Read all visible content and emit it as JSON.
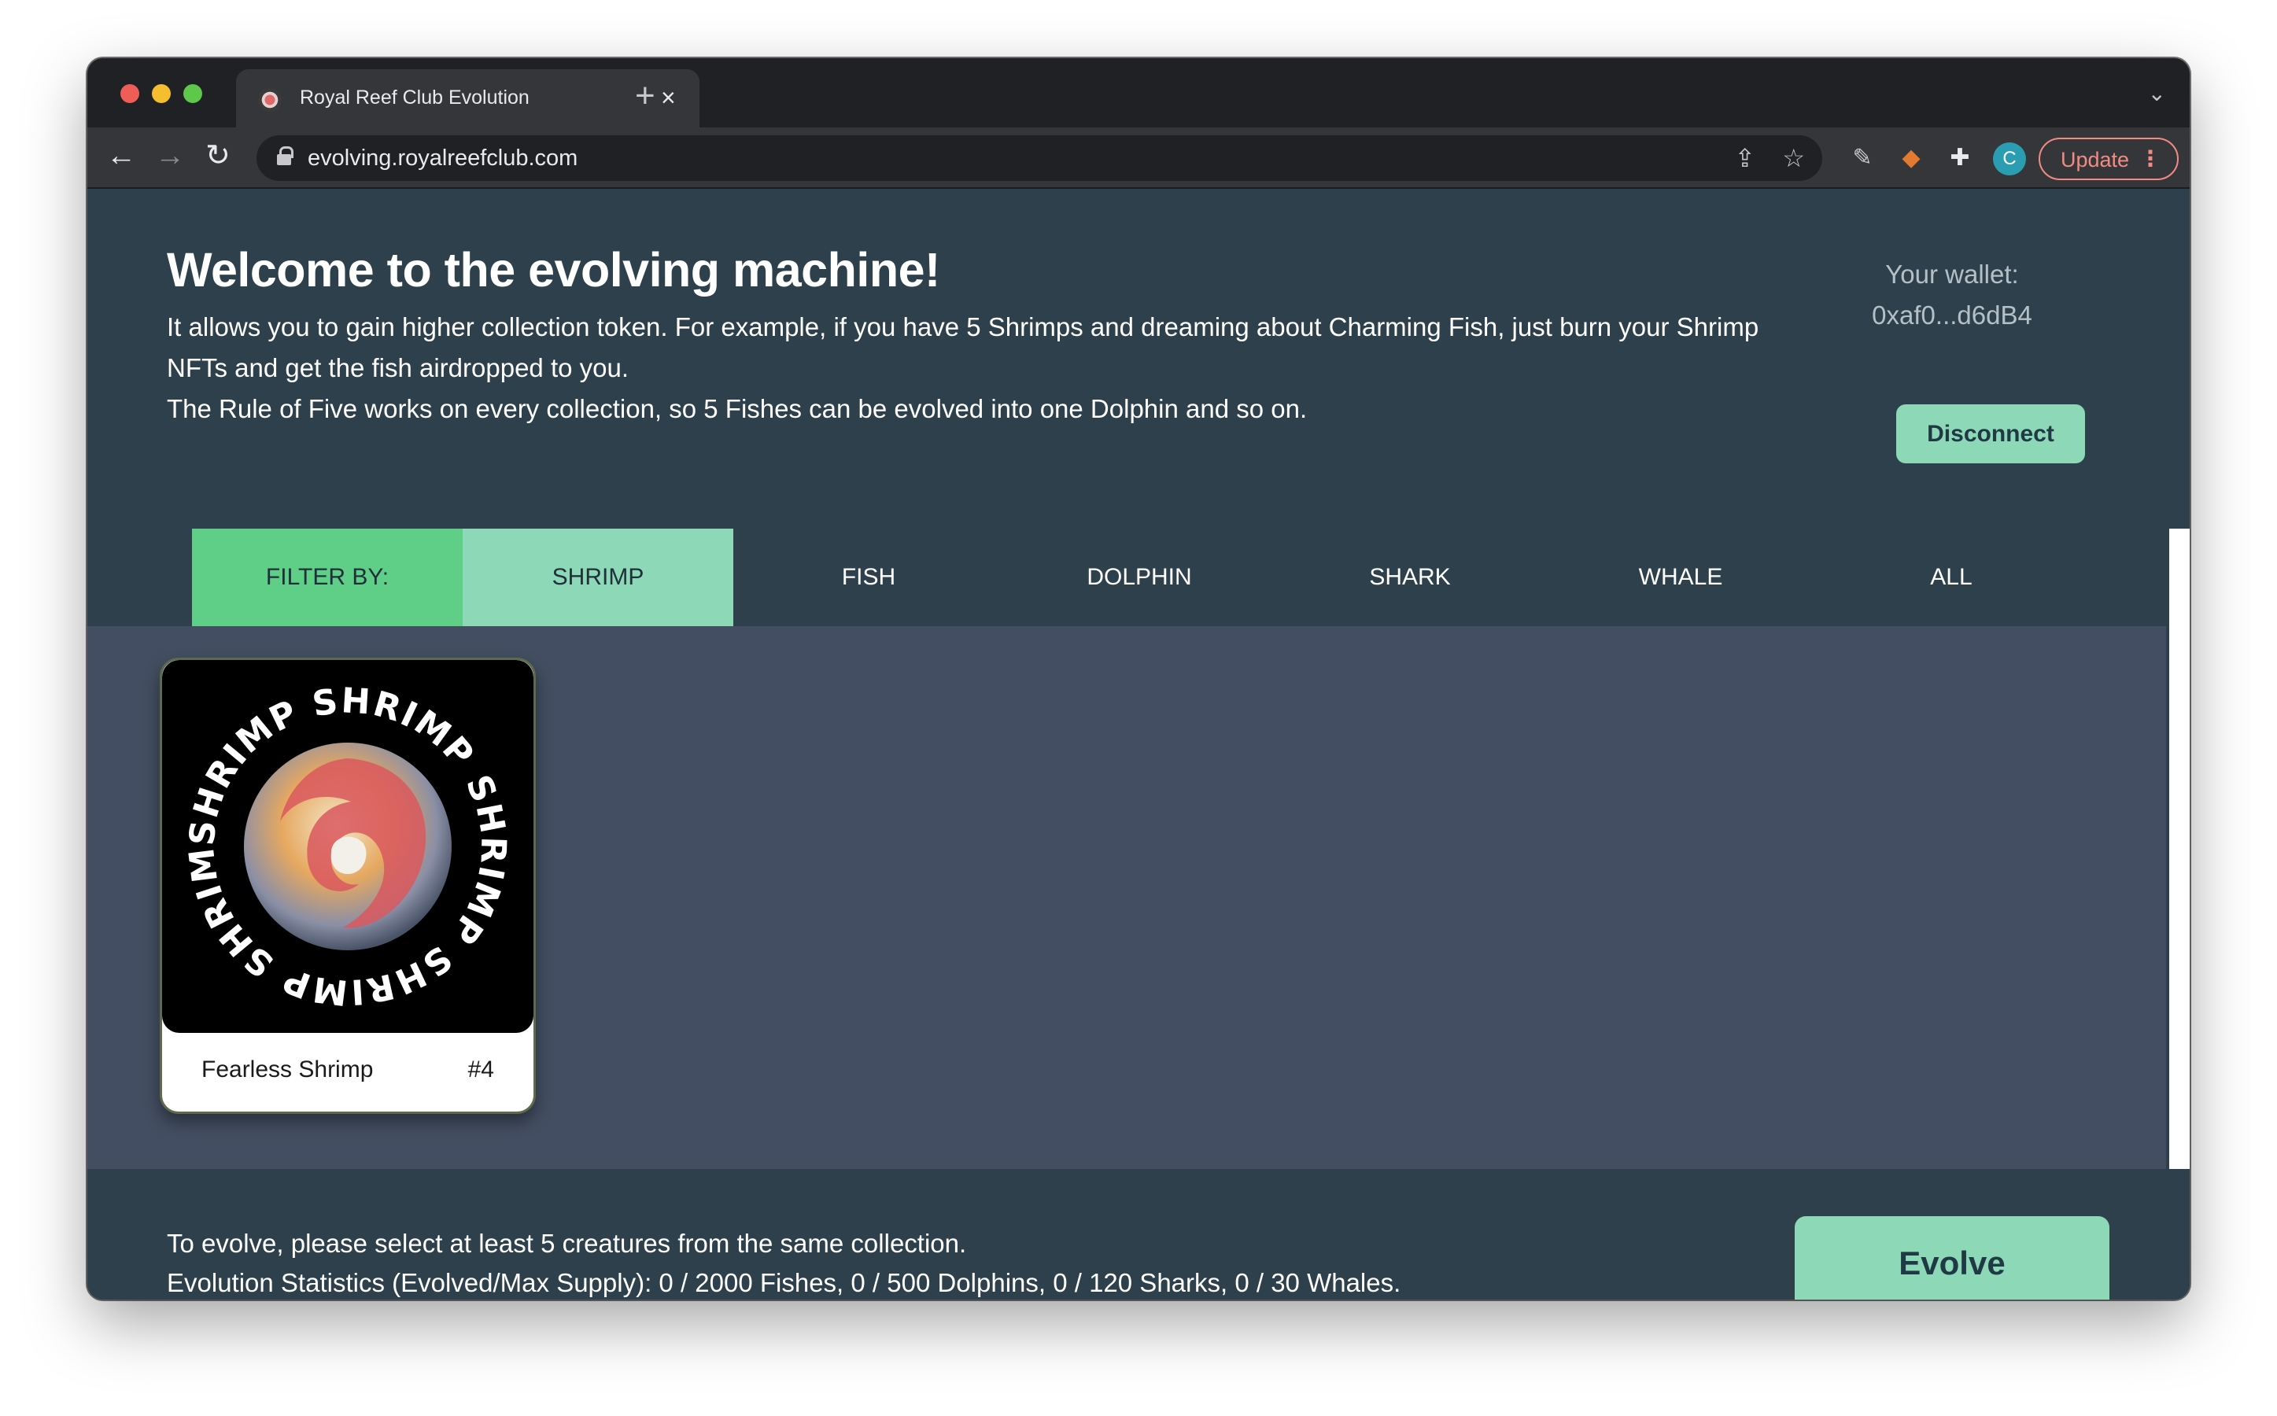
{
  "browser": {
    "tab_title": "Royal Reef Club Evolution",
    "tab_close": "×",
    "new_tab": "+",
    "url": "evolving.royalreefclub.com",
    "avatar_initial": "C",
    "update_label": "Update",
    "icons": [
      "back-arrow-icon",
      "forward-arrow-icon",
      "reload-icon",
      "lock-icon",
      "share-icon",
      "star-icon",
      "pen-extension-icon",
      "metamask-fox-icon",
      "puzzle-extension-icon",
      "menu-dots-icon"
    ]
  },
  "header": {
    "title": "Welcome to the evolving machine!",
    "intro_line1": "It allows you to gain higher collection token. For example, if you have 5 Shrimps and dreaming about Charming Fish, just burn your Shrimp NFTs and get the fish airdropped to you.",
    "intro_line2": "The Rule of Five works on every collection, so 5 Fishes can be evolved into one Dolphin and so on."
  },
  "wallet": {
    "label": "Your wallet:",
    "address": "0xaf0...d6dB4",
    "disconnect_label": "Disconnect"
  },
  "filters": {
    "label": "FILTER BY:",
    "items": [
      "SHRIMP",
      "FISH",
      "DOLPHIN",
      "SHARK",
      "WHALE",
      "ALL"
    ],
    "active": "SHRIMP"
  },
  "cards": [
    {
      "name": "Fearless Shrimp",
      "id": "#4",
      "ring_text": "SHRIMP SHRIMP SHRIMP SHRIMP SHRIMP"
    }
  ],
  "footer": {
    "line1": "To evolve, please select at least 5 creatures from the same collection.",
    "line2": "Evolution Statistics (Evolved/Max Supply): 0 / 2000 Fishes, 0 / 500 Dolphins, 0 / 120 Sharks, 0 / 30 Whales.",
    "evolve_label": "Evolve"
  },
  "colors": {
    "page_bg": "#2e404b",
    "grid_bg": "#434e62",
    "accent": "#8dd8b6",
    "filter_label_bg": "#5fcf88",
    "update_red": "#f28b82"
  }
}
